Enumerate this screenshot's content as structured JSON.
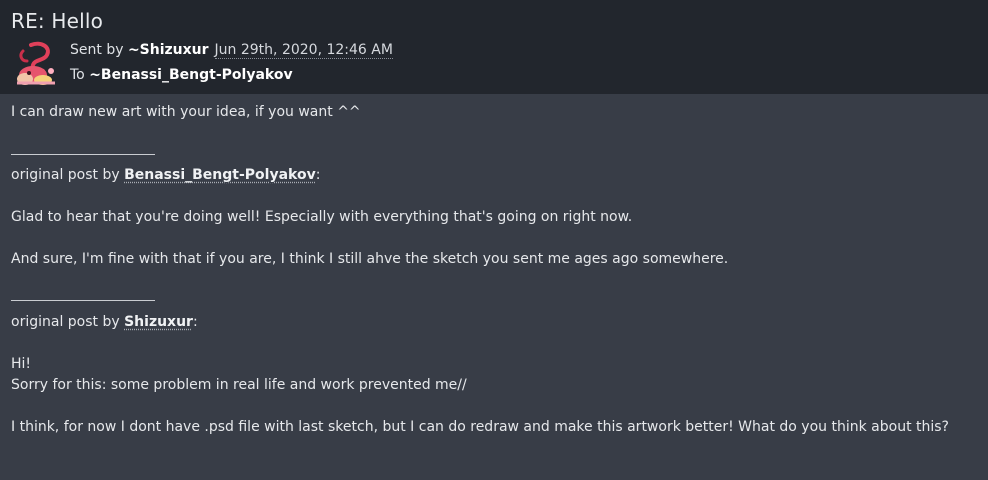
{
  "message": {
    "subject": "RE: Hello",
    "sent_prefix": "Sent by ",
    "sender": "~Shizuxur",
    "date": "Jun 29th, 2020, 12:46 AM",
    "to_prefix": "To ",
    "recipient": "~Benassi_Bengt-Polyakov"
  },
  "content": {
    "reply": "I can draw new art with your idea, if you want ^^",
    "quote1": {
      "prefix": "original post by ",
      "user": "Benassi_Bengt-Polyakov",
      "suffix": ":",
      "line1": "Glad to hear that you're doing well! Especially with everything that's going on right now.",
      "line2": "And sure, I'm fine with that if you are, I think I still ahve the sketch you sent me ages ago somewhere."
    },
    "quote2": {
      "prefix": "original post by ",
      "user": "Shizuxur",
      "suffix": ":",
      "line1": "Hi!",
      "line2": "Sorry for this: some problem in real life and work prevented me//",
      "line3": "I think, for now I dont have .psd file with last sketch, but I can do redraw and make this artwork better! What do you think about this?"
    }
  }
}
